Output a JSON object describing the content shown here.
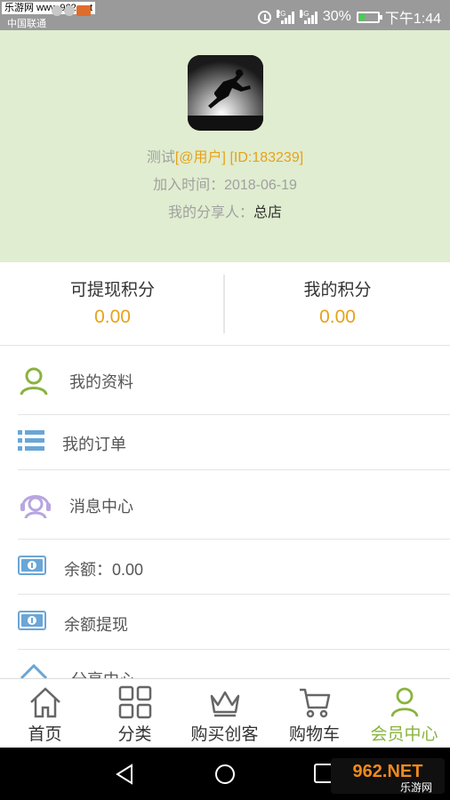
{
  "status_bar": {
    "watermark": "乐游网 www.962.net",
    "carrier": "中国联通",
    "net_2g": "2G",
    "net_4g": "4G",
    "battery": "30%",
    "battery_level": 0.3,
    "time": "下午1:44"
  },
  "profile": {
    "name": "测试",
    "role": "[@用户]",
    "id": "[ID:183239]",
    "join_label": "加入时间：",
    "join_date": "2018-06-19",
    "sharer_label": "我的分享人：",
    "sharer": "总店"
  },
  "points": {
    "withdrawable_label": "可提现积分",
    "withdrawable_value": "0.00",
    "mine_label": "我的积分",
    "mine_value": "0.00"
  },
  "menu": [
    {
      "label": "我的资料",
      "icon": "user-icon"
    },
    {
      "label": "我的订单",
      "icon": "list-icon"
    },
    {
      "label": "消息中心",
      "icon": "headset-icon"
    },
    {
      "label": "余额：0.00",
      "icon": "money-icon"
    },
    {
      "label": "余额提现",
      "icon": "money-icon"
    },
    {
      "label": "分享中心",
      "icon": "share-icon"
    }
  ],
  "tabs": [
    {
      "label": "首页",
      "icon": "home-icon"
    },
    {
      "label": "分类",
      "icon": "grid-icon"
    },
    {
      "label": "购买创客",
      "icon": "crown-icon"
    },
    {
      "label": "购物车",
      "icon": "cart-icon"
    },
    {
      "label": "会员中心",
      "icon": "member-icon",
      "active": true
    }
  ],
  "colors": {
    "accent": "#8ab33f",
    "orange": "#e6a21a",
    "header_bg": "#e0edd0",
    "icon_blue": "#6aa6d6",
    "icon_purple": "#b7a6e0"
  },
  "watermark_footer": {
    "logo": "962.NET",
    "name": "乐游网"
  }
}
